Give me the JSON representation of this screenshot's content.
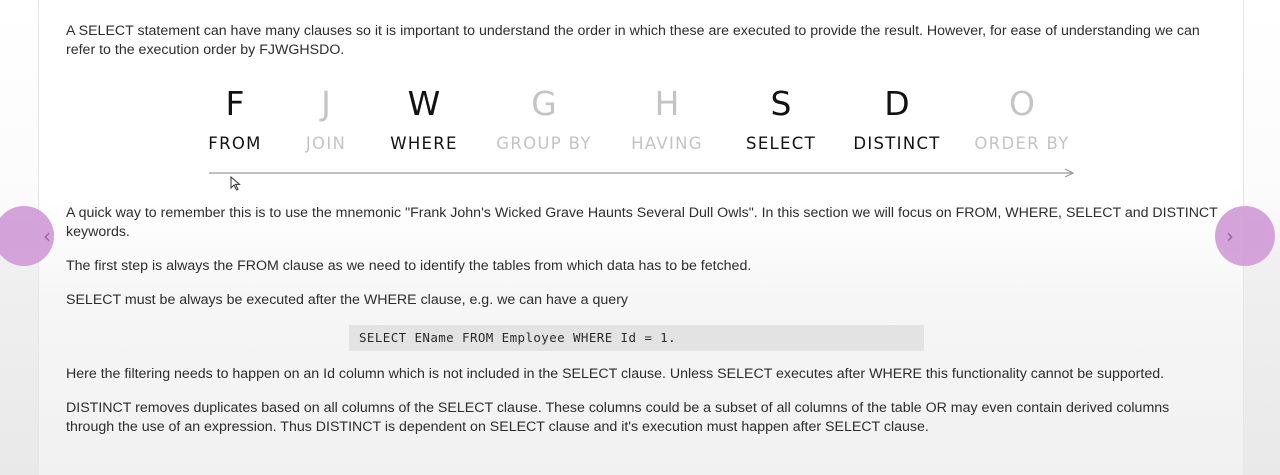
{
  "intro": "A SELECT statement can have many clauses so it is important to understand the order in which these are executed to provide the result. However, for ease of understanding we can refer to the execution order by FJWGHSDO.",
  "mnemonic": {
    "letters": [
      "F",
      "J",
      "W",
      "G",
      "H",
      "S",
      "D",
      "O"
    ],
    "words": [
      "FROM",
      "JOIN",
      "WHERE",
      "GROUP BY",
      "HAVING",
      "SELECT",
      "DISTINCT",
      "ORDER BY"
    ],
    "highlighted": [
      true,
      false,
      true,
      false,
      false,
      true,
      true,
      false
    ]
  },
  "paragraphs": {
    "remember": "A quick way to remember this is to use the mnemonic \"Frank John's Wicked Grave Haunts Several Dull Owls\". In this section we will focus on FROM, WHERE, SELECT and DISTINCT keywords.",
    "first_step": "The first step is always the FROM clause as we need to identify the tables from which data has to be fetched.",
    "select_after_where": "SELECT must be always be executed after the WHERE clause, e.g. we can have a query",
    "filtering": "Here the filtering needs to happen on an Id column which is not included in the SELECT clause. Unless SELECT executes after WHERE this functionality cannot be supported.",
    "distinct": "DISTINCT removes duplicates based on all columns of the SELECT clause. These columns could be a subset of all columns of the table OR may even contain derived columns through the use of an expression. Thus DISTINCT is dependent on SELECT clause and it's execution must happen after SELECT clause."
  },
  "code_sample": "SELECT EName FROM Employee WHERE Id = 1.",
  "nav": {
    "prev_icon": "chevron-left-icon",
    "next_icon": "chevron-right-icon",
    "prev_glyph": "‹",
    "next_glyph": "›",
    "color": "#cf9ad6"
  }
}
